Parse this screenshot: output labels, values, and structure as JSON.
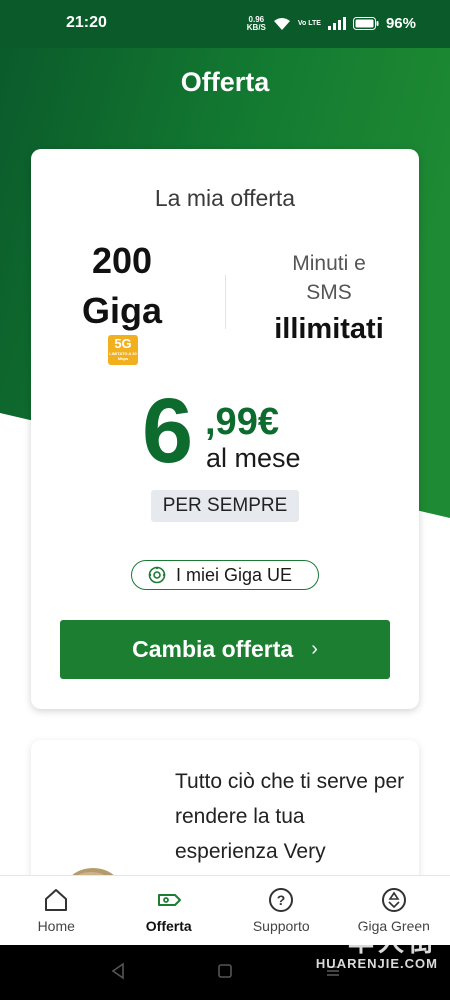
{
  "status_bar": {
    "time": "21:20",
    "net_speed": "0.96",
    "net_unit": "KB/S",
    "volte": "Vo LTE",
    "battery": "96%"
  },
  "header": {
    "title": "Offerta"
  },
  "offer": {
    "title": "La mia offerta",
    "giga_amount": "200",
    "giga_unit": "Giga",
    "badge_5g": "5G",
    "badge_5g_sub": "LIMITATO A 30 Mbps",
    "minutes_label_line1": "Minuti e",
    "minutes_label_line2": "SMS",
    "minutes_value": "illimitati",
    "price_integer": "6",
    "price_decimal": ",99€",
    "price_period": "al mese",
    "forever_tag": "PER SEMPRE",
    "giga_ue_label": "I miei Giga UE",
    "change_button": "Cambia offerta"
  },
  "promo": {
    "text": "Tutto ciò che ti serve per rendere la tua esperienza Very"
  },
  "bottom_nav": [
    {
      "label": "Home",
      "icon": "home-icon"
    },
    {
      "label": "Offerta",
      "icon": "offer-tag-icon",
      "active": true
    },
    {
      "label": "Supporto",
      "icon": "help-icon"
    },
    {
      "label": "Giga Green",
      "icon": "recycle-icon"
    }
  ],
  "watermark": {
    "cn": "华人街",
    "latin": "HUARENJIE.COM"
  },
  "colors": {
    "brand_green": "#1b7e30",
    "dark_green": "#0a5a2a",
    "price_green": "#0d6b2e",
    "badge_yellow": "#f2b01e"
  }
}
